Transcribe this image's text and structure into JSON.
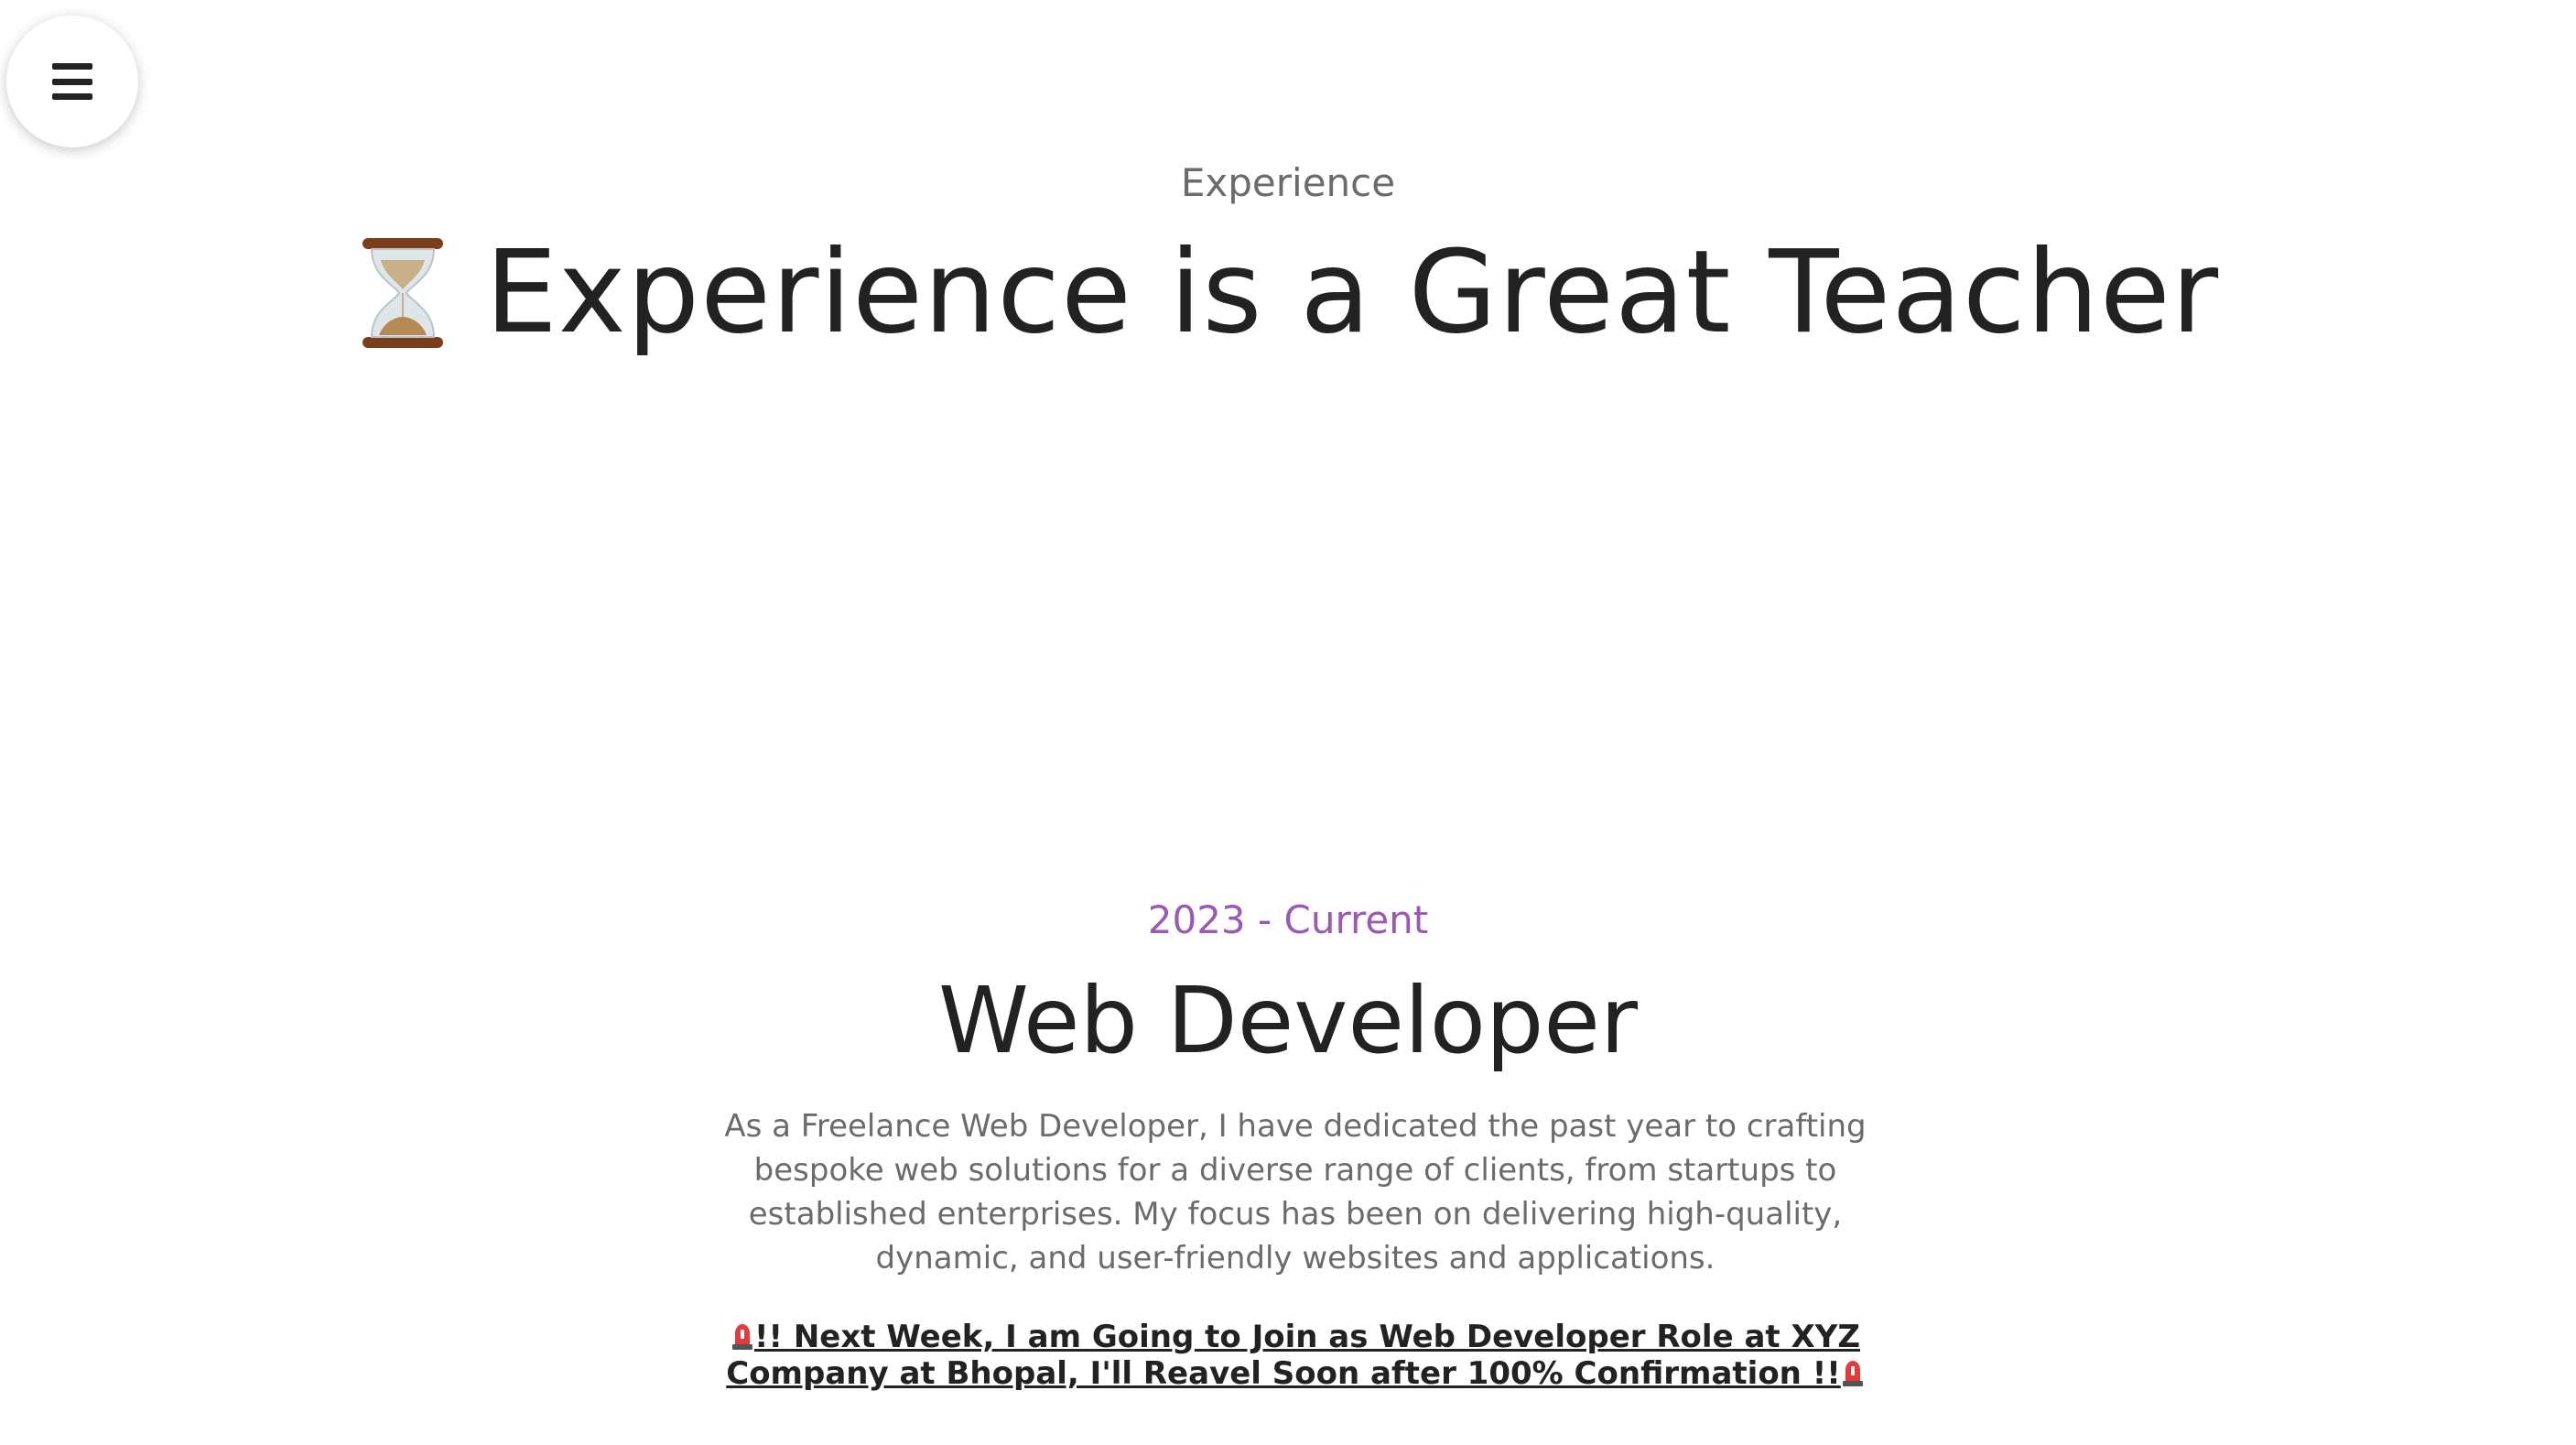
{
  "menu": {
    "icon": "hamburger-menu-icon"
  },
  "header": {
    "section_label": "Experience",
    "title": "Experience is a Great Teacher",
    "title_icon": "hourglass-icon"
  },
  "experience": {
    "period": "2023 - Current",
    "role": "Web Developer",
    "description": "As a Freelance Web Developer, I have dedicated the past year to crafting bespoke web solutions for a diverse range of clients, from startups to established enterprises. My focus has been on delivering high-quality, dynamic, and user-friendly websites and applications.",
    "notice": "!! Next Week, I am Going to Join as Web Developer Role at XYZ Company at Bhopal, I'll Reavel Soon after 100% Confirmation !!",
    "notice_icon": "siren-icon"
  },
  "colors": {
    "accent": "#9b59b6",
    "heading": "#222222",
    "muted": "#6b6b6b",
    "background": "#ffffff"
  }
}
